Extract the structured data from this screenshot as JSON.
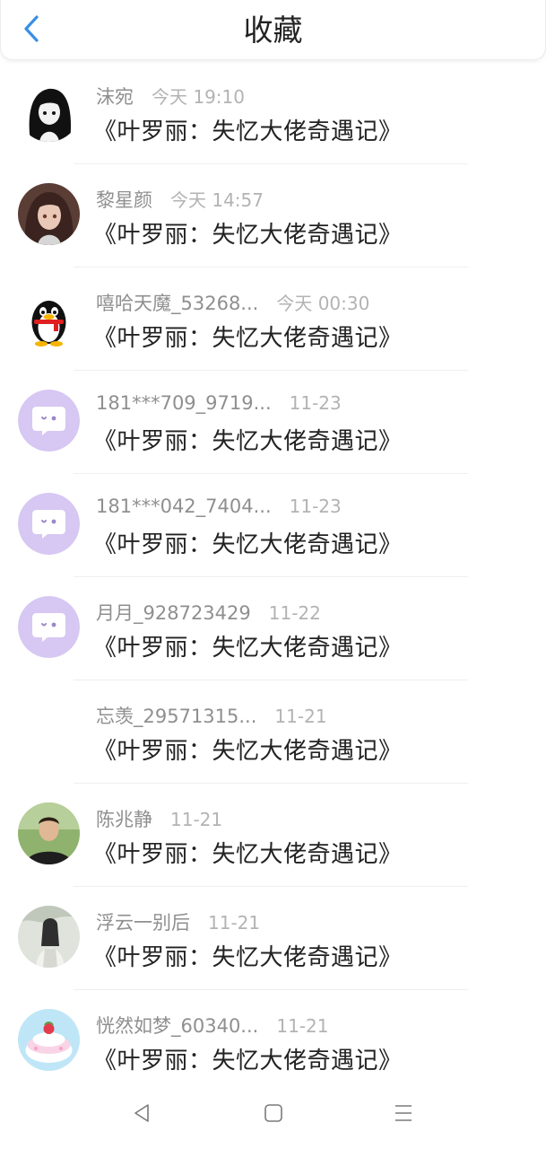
{
  "header": {
    "title": "收藏",
    "back_icon": "chevron-left-icon"
  },
  "accent_color": "#3a8ee6",
  "items": [
    {
      "name": "沫宛",
      "time": "今天 19:10",
      "book": "《叶罗丽：失忆大佬奇遇记》",
      "avatar": "anime-girl-bw"
    },
    {
      "name": "黎星颜",
      "time": "今天 14:57",
      "book": "《叶罗丽：失忆大佬奇遇记》",
      "avatar": "anime-girl-color"
    },
    {
      "name": "嘻哈天魔_53268...",
      "time": "今天 00:30",
      "book": "《叶罗丽：失忆大佬奇遇记》",
      "avatar": "qq-penguin"
    },
    {
      "name": "181***709_9719...",
      "time": "11-23",
      "book": "《叶罗丽：失忆大佬奇遇记》",
      "avatar": "default-chat-bubble"
    },
    {
      "name": "181***042_7404...",
      "time": "11-23",
      "book": "《叶罗丽：失忆大佬奇遇记》",
      "avatar": "default-chat-bubble"
    },
    {
      "name": "月月_928723429",
      "time": "11-22",
      "book": "《叶罗丽：失忆大佬奇遇记》",
      "avatar": "default-chat-bubble"
    },
    {
      "name": "忘羡_29571315...",
      "time": "11-21",
      "book": "《叶罗丽：失忆大佬奇遇记》",
      "avatar": "none"
    },
    {
      "name": "陈兆静",
      "time": "11-21",
      "book": "《叶罗丽：失忆大佬奇遇记》",
      "avatar": "person-photo"
    },
    {
      "name": "浮云一别后",
      "time": "11-21",
      "book": "《叶罗丽：失忆大佬奇遇记》",
      "avatar": "ancient-figure"
    },
    {
      "name": "恍然如梦_60340...",
      "time": "11-21",
      "book": "《叶罗丽：失忆大佬奇遇记》",
      "avatar": "cake-illustration"
    }
  ],
  "navbar": {
    "back": "triangle-back-icon",
    "home": "square-home-icon",
    "menu": "menu-lines-icon"
  }
}
